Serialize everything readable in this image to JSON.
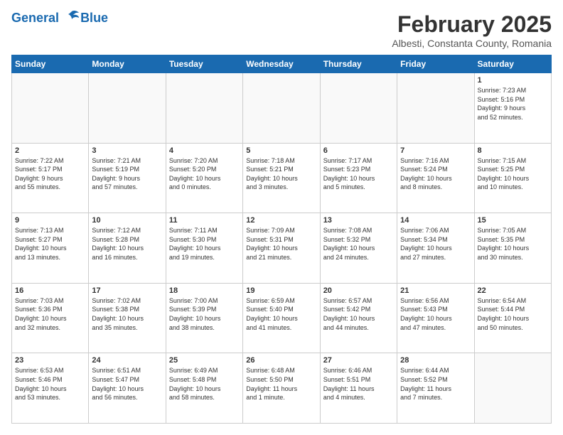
{
  "logo": {
    "line1": "General",
    "line2": "Blue"
  },
  "title": "February 2025",
  "location": "Albesti, Constanta County, Romania",
  "days_of_week": [
    "Sunday",
    "Monday",
    "Tuesday",
    "Wednesday",
    "Thursday",
    "Friday",
    "Saturday"
  ],
  "weeks": [
    [
      {
        "num": "",
        "info": ""
      },
      {
        "num": "",
        "info": ""
      },
      {
        "num": "",
        "info": ""
      },
      {
        "num": "",
        "info": ""
      },
      {
        "num": "",
        "info": ""
      },
      {
        "num": "",
        "info": ""
      },
      {
        "num": "1",
        "info": "Sunrise: 7:23 AM\nSunset: 5:16 PM\nDaylight: 9 hours\nand 52 minutes."
      }
    ],
    [
      {
        "num": "2",
        "info": "Sunrise: 7:22 AM\nSunset: 5:17 PM\nDaylight: 9 hours\nand 55 minutes."
      },
      {
        "num": "3",
        "info": "Sunrise: 7:21 AM\nSunset: 5:19 PM\nDaylight: 9 hours\nand 57 minutes."
      },
      {
        "num": "4",
        "info": "Sunrise: 7:20 AM\nSunset: 5:20 PM\nDaylight: 10 hours\nand 0 minutes."
      },
      {
        "num": "5",
        "info": "Sunrise: 7:18 AM\nSunset: 5:21 PM\nDaylight: 10 hours\nand 3 minutes."
      },
      {
        "num": "6",
        "info": "Sunrise: 7:17 AM\nSunset: 5:23 PM\nDaylight: 10 hours\nand 5 minutes."
      },
      {
        "num": "7",
        "info": "Sunrise: 7:16 AM\nSunset: 5:24 PM\nDaylight: 10 hours\nand 8 minutes."
      },
      {
        "num": "8",
        "info": "Sunrise: 7:15 AM\nSunset: 5:25 PM\nDaylight: 10 hours\nand 10 minutes."
      }
    ],
    [
      {
        "num": "9",
        "info": "Sunrise: 7:13 AM\nSunset: 5:27 PM\nDaylight: 10 hours\nand 13 minutes."
      },
      {
        "num": "10",
        "info": "Sunrise: 7:12 AM\nSunset: 5:28 PM\nDaylight: 10 hours\nand 16 minutes."
      },
      {
        "num": "11",
        "info": "Sunrise: 7:11 AM\nSunset: 5:30 PM\nDaylight: 10 hours\nand 19 minutes."
      },
      {
        "num": "12",
        "info": "Sunrise: 7:09 AM\nSunset: 5:31 PM\nDaylight: 10 hours\nand 21 minutes."
      },
      {
        "num": "13",
        "info": "Sunrise: 7:08 AM\nSunset: 5:32 PM\nDaylight: 10 hours\nand 24 minutes."
      },
      {
        "num": "14",
        "info": "Sunrise: 7:06 AM\nSunset: 5:34 PM\nDaylight: 10 hours\nand 27 minutes."
      },
      {
        "num": "15",
        "info": "Sunrise: 7:05 AM\nSunset: 5:35 PM\nDaylight: 10 hours\nand 30 minutes."
      }
    ],
    [
      {
        "num": "16",
        "info": "Sunrise: 7:03 AM\nSunset: 5:36 PM\nDaylight: 10 hours\nand 32 minutes."
      },
      {
        "num": "17",
        "info": "Sunrise: 7:02 AM\nSunset: 5:38 PM\nDaylight: 10 hours\nand 35 minutes."
      },
      {
        "num": "18",
        "info": "Sunrise: 7:00 AM\nSunset: 5:39 PM\nDaylight: 10 hours\nand 38 minutes."
      },
      {
        "num": "19",
        "info": "Sunrise: 6:59 AM\nSunset: 5:40 PM\nDaylight: 10 hours\nand 41 minutes."
      },
      {
        "num": "20",
        "info": "Sunrise: 6:57 AM\nSunset: 5:42 PM\nDaylight: 10 hours\nand 44 minutes."
      },
      {
        "num": "21",
        "info": "Sunrise: 6:56 AM\nSunset: 5:43 PM\nDaylight: 10 hours\nand 47 minutes."
      },
      {
        "num": "22",
        "info": "Sunrise: 6:54 AM\nSunset: 5:44 PM\nDaylight: 10 hours\nand 50 minutes."
      }
    ],
    [
      {
        "num": "23",
        "info": "Sunrise: 6:53 AM\nSunset: 5:46 PM\nDaylight: 10 hours\nand 53 minutes."
      },
      {
        "num": "24",
        "info": "Sunrise: 6:51 AM\nSunset: 5:47 PM\nDaylight: 10 hours\nand 56 minutes."
      },
      {
        "num": "25",
        "info": "Sunrise: 6:49 AM\nSunset: 5:48 PM\nDaylight: 10 hours\nand 58 minutes."
      },
      {
        "num": "26",
        "info": "Sunrise: 6:48 AM\nSunset: 5:50 PM\nDaylight: 11 hours\nand 1 minute."
      },
      {
        "num": "27",
        "info": "Sunrise: 6:46 AM\nSunset: 5:51 PM\nDaylight: 11 hours\nand 4 minutes."
      },
      {
        "num": "28",
        "info": "Sunrise: 6:44 AM\nSunset: 5:52 PM\nDaylight: 11 hours\nand 7 minutes."
      },
      {
        "num": "",
        "info": ""
      }
    ]
  ]
}
